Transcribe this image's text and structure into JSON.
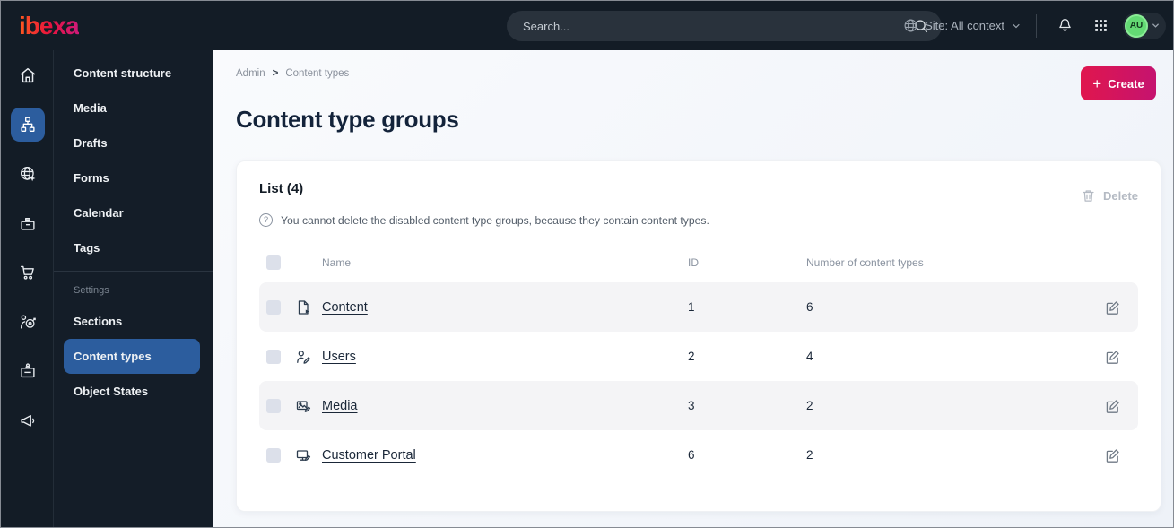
{
  "topbar": {
    "logo_text": "ibexa",
    "search_placeholder": "Search...",
    "site_context_label": "Site: All context",
    "avatar_initials": "AU"
  },
  "icon_rail": {
    "items": [
      "home-icon",
      "content-structure-icon (active)",
      "site-globe-icon",
      "products-icon",
      "commerce-cart-icon",
      "personalization-target-icon",
      "corporate-badge-icon",
      "marketing-megaphone-icon"
    ]
  },
  "sidebar": {
    "items": [
      "Content structure",
      "Media",
      "Drafts",
      "Forms",
      "Calendar",
      "Tags"
    ],
    "section_label": "Settings",
    "settings_items": [
      "Sections",
      "Content types",
      "Object States"
    ],
    "active_item": "Content types"
  },
  "page": {
    "breadcrumb": {
      "items": [
        "Admin",
        "Content types"
      ],
      "separator": ">"
    },
    "create_plus": "+",
    "create_button": "Create",
    "title": "Content type groups"
  },
  "list": {
    "title": "List (4)",
    "info_icon": "?",
    "info_text": "You cannot delete the disabled content type groups, because they contain content types.",
    "delete_button": "Delete",
    "columns": {
      "name": "Name",
      "id": "ID",
      "count": "Number of content types"
    },
    "rows": [
      {
        "icon": "content-file-icon",
        "name": "Content",
        "id": "1",
        "count": "6"
      },
      {
        "icon": "users-icon",
        "name": "Users",
        "id": "2",
        "count": "4"
      },
      {
        "icon": "media-image-icon",
        "name": "Media",
        "id": "3",
        "count": "2"
      },
      {
        "icon": "customer-portal-monitor-icon",
        "name": "Customer Portal",
        "id": "6",
        "count": "2"
      }
    ]
  },
  "colors": {
    "topbar_bg": "#131c26",
    "sidebar_bg": "#141d28",
    "accent_blue": "#2c5d9e",
    "primary_pink_gradient": [
      "#e0164e",
      "#c5136f"
    ],
    "row_alt_bg": "#f4f4f6",
    "avatar_green": "#63da74",
    "muted_text": "#8a93a0"
  }
}
